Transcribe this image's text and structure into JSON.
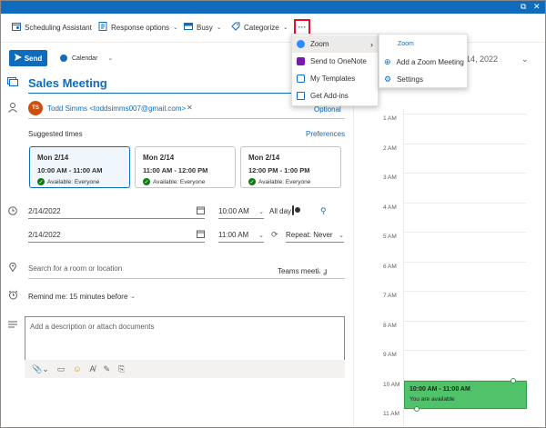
{
  "ribbon": {
    "scheduling_assistant": "Scheduling Assistant",
    "response_options": "Response options",
    "busy": "Busy",
    "categorize": "Categorize",
    "more": "···"
  },
  "send": {
    "label": "Send"
  },
  "calendar_picker": {
    "label": "Calendar"
  },
  "event_title": "Sales Meeting",
  "attendee": {
    "initials": "TS",
    "display": "Todd Simms <toddsimms007@gmail.com>",
    "remove": "✕",
    "optional": "Optional"
  },
  "suggested": {
    "heading": "Suggested times",
    "preferences": "Preferences",
    "slots": [
      {
        "day": "Mon 2/14",
        "time": "10:00 AM - 11:00 AM",
        "avail": "Available: Everyone"
      },
      {
        "day": "Mon 2/14",
        "time": "11:00 AM - 12:00 PM",
        "avail": "Available: Everyone"
      },
      {
        "day": "Mon 2/14",
        "time": "12:00 PM - 1:00 PM",
        "avail": "Available: Everyone"
      }
    ]
  },
  "start": {
    "date": "2/14/2022",
    "time": "10:00 AM"
  },
  "end": {
    "date": "2/14/2022",
    "time": "11:00 AM"
  },
  "all_day": "All day",
  "repeat": "Repeat: Never",
  "location": {
    "placeholder": "Search for a room or location"
  },
  "teams_meeting": "Teams meeting",
  "reminder": "Remind me: 15 minutes before",
  "description": {
    "placeholder": "Add a description or attach documents"
  },
  "calendar": {
    "date_header": "14, 2022",
    "hours": [
      "1 AM",
      "2 AM",
      "3 AM",
      "4 AM",
      "5 AM",
      "6 AM",
      "7 AM",
      "8 AM",
      "9 AM",
      "10 AM",
      "11 AM"
    ],
    "event": {
      "time": "10:00 AM - 11:00 AM",
      "status": "You are available"
    }
  },
  "more_menu": {
    "items": [
      "Zoom",
      "Send to OneNote",
      "My Templates",
      "Get Add-ins"
    ]
  },
  "zoom_submenu": {
    "header": "Zoom",
    "items": [
      "Add a Zoom Meeting",
      "Settings"
    ]
  },
  "colors": {
    "accent": "#0f6cbd",
    "available": "#107c10",
    "event_fill": "#4fc26a",
    "highlight_border": "#e81123"
  }
}
